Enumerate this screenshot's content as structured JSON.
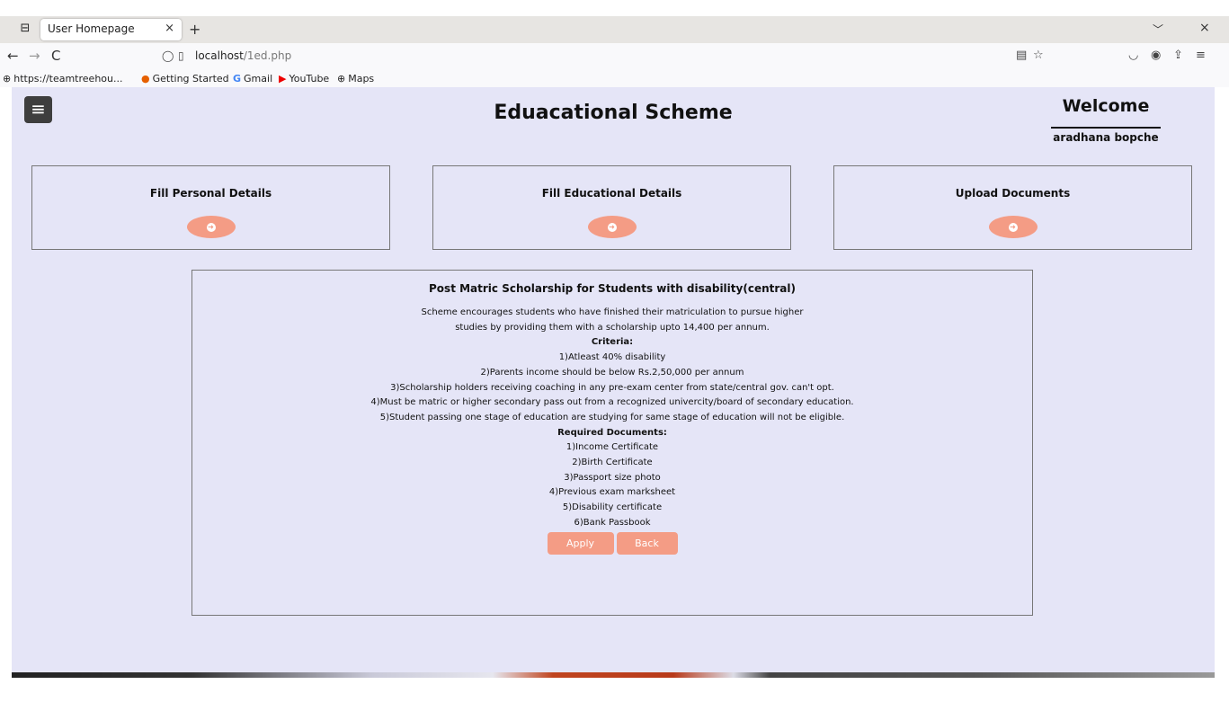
{
  "browser": {
    "tab_title": "User Homepage",
    "tab_close": "×",
    "new_tab": "+",
    "tabs_menu": "﹀",
    "window_close": "×",
    "nav": {
      "back": "←",
      "forward": "→",
      "reload": "C"
    },
    "url_host": "localhost",
    "url_path": "/1ed.php",
    "bookmarks": [
      {
        "icon": "globe-icon",
        "label": "https://teamtreehou..."
      },
      {
        "icon": "firefox-icon",
        "label": "Getting Started"
      },
      {
        "icon": "gmail-icon",
        "label": "Gmail"
      },
      {
        "icon": "youtube-icon",
        "label": "YouTube"
      },
      {
        "icon": "globe-icon",
        "label": "Maps"
      }
    ]
  },
  "header": {
    "title": "Eduacational Scheme",
    "welcome": "Welcome",
    "username": "aradhana bopche"
  },
  "cards": [
    {
      "title": "Fill Personal Details"
    },
    {
      "title": "Fill Educational Details"
    },
    {
      "title": "Upload Documents"
    }
  ],
  "scheme": {
    "title": "Post Matric Scholarship for Students with disability(central)",
    "desc_line1": "Scheme encourages students who have finished their matriculation to pursue higher",
    "desc_line2": "studies by providing them with a scholarship upto 14,400 per annum.",
    "criteria_heading": "Criteria:",
    "criteria": [
      "1)Atleast 40% disability",
      "2)Parents income should be below Rs.2,50,000 per annum",
      "3)Scholarship holders receiving coaching in any pre-exam center from state/central gov. can't opt.",
      "4)Must be matric or higher secondary pass out from a recognized univercity/board of secondary education.",
      "5)Student passing one stage of education are studying for same stage of education will not be eligible."
    ],
    "documents_heading": "Required Documents:",
    "documents": [
      "1)Income Certificate",
      "2)Birth Certificate",
      "3)Passport size photo",
      "4)Previous exam marksheet",
      "5)Disability certificate",
      "6)Bank Passbook"
    ],
    "apply_label": "Apply",
    "back_label": "Back"
  },
  "colors": {
    "page_bg": "#e5e5f7",
    "accent": "#f49c85",
    "menu_button": "#3e3e3e"
  }
}
